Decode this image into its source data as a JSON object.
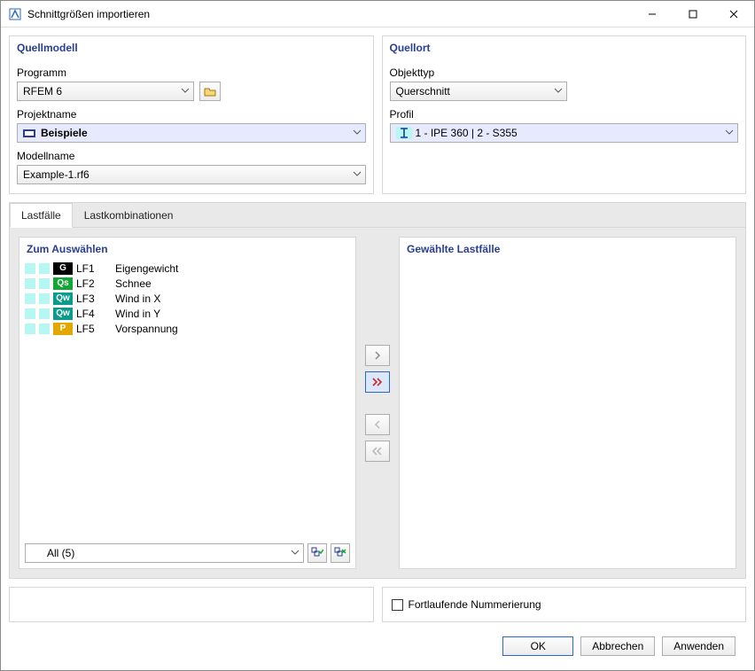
{
  "window": {
    "title": "Schnittgrößen importieren"
  },
  "source_model": {
    "header": "Quellmodell",
    "program_label": "Programm",
    "program_value": "RFEM 6",
    "project_label": "Projektname",
    "project_value": "Beispiele",
    "model_label": "Modellname",
    "model_value": "Example-1.rf6"
  },
  "source_location": {
    "header": "Quellort",
    "objecttype_label": "Objekttyp",
    "objecttype_value": "Querschnitt",
    "profile_label": "Profil",
    "profile_value": "1 - IPE 360 | 2 - S355"
  },
  "tabs": {
    "loadcases": "Lastfälle",
    "loadcombos": "Lastkombinationen"
  },
  "available": {
    "header": "Zum Auswählen",
    "items": [
      {
        "sw": "#b6f6f3",
        "tag_bg": "#000000",
        "tag": "G",
        "id": "LF1",
        "name": "Eigengewicht"
      },
      {
        "sw": "#b6f6f3",
        "tag_bg": "#12a637",
        "tag": "Qs",
        "id": "LF2",
        "name": "Schnee"
      },
      {
        "sw": "#b6f6f3",
        "tag_bg": "#0a9c8a",
        "tag": "Qw",
        "id": "LF3",
        "name": "Wind in X"
      },
      {
        "sw": "#b6f6f3",
        "tag_bg": "#0a9c8a",
        "tag": "Qw",
        "id": "LF4",
        "name": "Wind in Y"
      },
      {
        "sw": "#b6f6f3",
        "tag_bg": "#e0a800",
        "tag": "P",
        "id": "LF5",
        "name": "Vorspannung"
      }
    ],
    "filter": "All (5)"
  },
  "selected": {
    "header": "Gewählte Lastfälle"
  },
  "options": {
    "continuous_numbering": "Fortlaufende Nummerierung"
  },
  "footer": {
    "ok": "OK",
    "cancel": "Abbrechen",
    "apply": "Anwenden"
  }
}
